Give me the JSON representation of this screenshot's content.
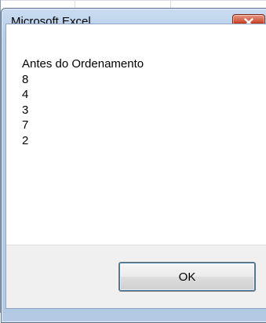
{
  "dialog": {
    "title": "Microsoft Excel",
    "close_icon": "close-icon",
    "message_lines": [
      "Antes do Ordenamento",
      "8",
      "4",
      "3",
      "7",
      "2"
    ],
    "ok_label": "OK"
  },
  "colors": {
    "title_bar": "#bad0ea",
    "close_button": "#c9452a",
    "footer": "#f0f0f0",
    "ok_focus_ring": "#3c7fb1"
  }
}
